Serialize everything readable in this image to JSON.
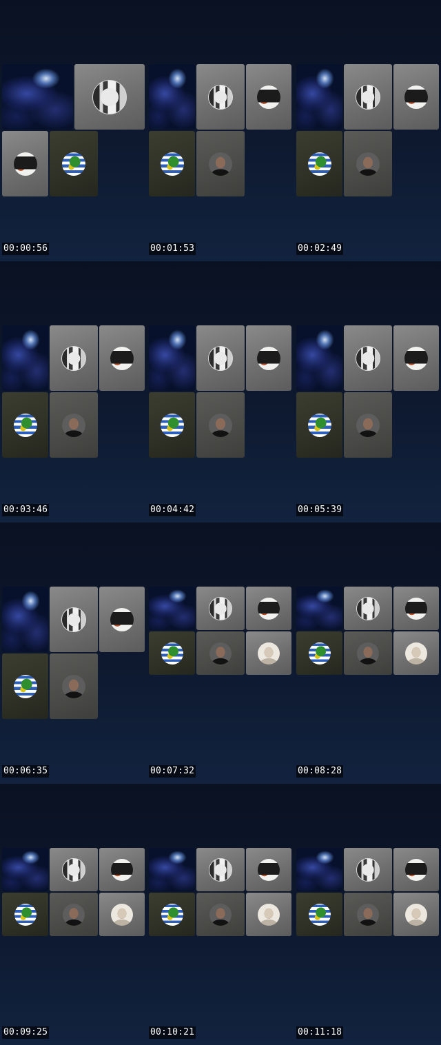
{
  "contact_sheet": {
    "frames": [
      {
        "timestamp": "00:00:56",
        "tile_count": 4
      },
      {
        "timestamp": "00:01:53",
        "tile_count": 5
      },
      {
        "timestamp": "00:02:49",
        "tile_count": 5
      },
      {
        "timestamp": "00:03:46",
        "tile_count": 5
      },
      {
        "timestamp": "00:04:42",
        "tile_count": 5
      },
      {
        "timestamp": "00:05:39",
        "tile_count": 5
      },
      {
        "timestamp": "00:06:35",
        "tile_count": 5
      },
      {
        "timestamp": "00:07:32",
        "tile_count": 6
      },
      {
        "timestamp": "00:08:28",
        "tile_count": 6
      },
      {
        "timestamp": "00:09:25",
        "tile_count": 6
      },
      {
        "timestamp": "00:10:21",
        "tile_count": 6
      },
      {
        "timestamp": "00:11:18",
        "tile_count": 6
      }
    ],
    "participants": [
      {
        "id": "nebula-background",
        "icon": "nebula-image"
      },
      {
        "id": "screen-share-avatar",
        "icon": "monochrome-screen-avatar"
      },
      {
        "id": "poster-avatar",
        "icon": "black-white-poster-avatar"
      },
      {
        "id": "frog-flag-avatar",
        "icon": "green-frog-avatar"
      },
      {
        "id": "man-avatar",
        "icon": "dark-portrait-avatar"
      },
      {
        "id": "bald-man-avatar",
        "icon": "sepia-portrait-avatar"
      }
    ],
    "colors": {
      "background_top": "#0a1122",
      "background_bottom": "#12233f",
      "tile_grey": "#6f6f6f",
      "tile_dark": "#4a4a47",
      "tile_olive": "#2f3126",
      "timestamp_text": "#ffffff",
      "timestamp_bg": "#000000"
    }
  }
}
